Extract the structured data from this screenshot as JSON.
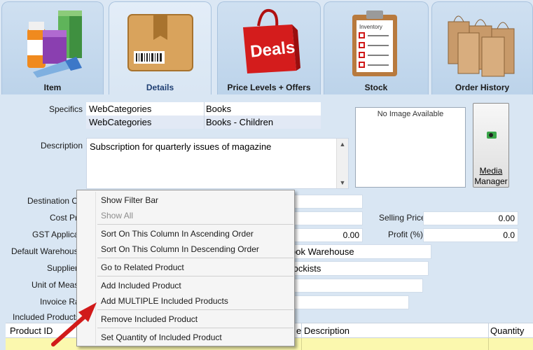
{
  "tabs": [
    {
      "label": "Item",
      "icon": "products-icon"
    },
    {
      "label": "Details",
      "icon": "package-icon"
    },
    {
      "label": "Price Levels + Offers",
      "icon": "deals-bag-icon"
    },
    {
      "label": "Stock",
      "icon": "inventory-clipboard-icon"
    },
    {
      "label": "Order History",
      "icon": "shopping-bags-icon"
    }
  ],
  "details": {
    "specifics_label": "Specifics",
    "specifics": [
      {
        "key": "WebCategories",
        "value": "Books"
      },
      {
        "key": "WebCategories",
        "value": "Books - Children"
      }
    ],
    "description_label": "Description",
    "description": "Subscription for quarterly issues of magazine",
    "image_placeholder": "No Image Available",
    "media_button_line1": "Media",
    "media_button_line2": "Manager",
    "destination_label": "Destination Co",
    "cost_label": "Cost Pri",
    "gst_label": "GST Applicab",
    "gst_value": "0.00",
    "warehouse_label": "Default Warehouse",
    "warehouse_value": "ook Warehouse",
    "supplier_label": "Supplier",
    "supplier_value": "tockists",
    "unit_label": "Unit of Measu",
    "invoice_label": "Invoice Ra",
    "included_products_label": "Included Products",
    "selling_price_label": "Selling Price",
    "selling_price_value": "0.00",
    "profit_label": "Profit (%)",
    "profit_value": "0.0"
  },
  "grid": {
    "columns": [
      "Product ID",
      "e",
      "Description",
      "Quantity"
    ]
  },
  "context_menu": {
    "items": [
      {
        "label": "Show Filter Bar",
        "enabled": true
      },
      {
        "label": "Show All",
        "enabled": false
      },
      {
        "label": "Sort On This Column In Ascending Order",
        "enabled": true
      },
      {
        "label": "Sort On This Column In Descending Order",
        "enabled": true
      },
      {
        "label": "Go to Related Product",
        "enabled": true
      },
      {
        "label": "Add Included Product",
        "enabled": true
      },
      {
        "label": "Add MULTIPLE Included Products",
        "enabled": true
      },
      {
        "label": "Remove Included Product",
        "enabled": true
      },
      {
        "label": "Set Quantity of Included Product",
        "enabled": true
      }
    ]
  },
  "colors": {
    "background": "#d9e6f3",
    "active_tab_text": "#1f3f73",
    "grid_row": "#fbf8ae",
    "arrow": "#d11a1a"
  }
}
